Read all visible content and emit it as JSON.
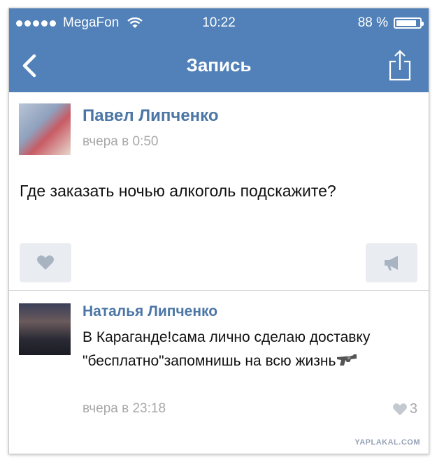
{
  "status_bar": {
    "carrier": "MegaFon",
    "time": "10:22",
    "battery_text": "88 %",
    "battery_level": 0.88
  },
  "nav": {
    "title": "Запись",
    "back_icon": "chevron-left-icon",
    "share_icon": "share-icon"
  },
  "post": {
    "author": "Павел Липченко",
    "date": "вчера в 0:50",
    "text": "Где заказать ночью алкоголь подскажите?"
  },
  "comment": {
    "author": "Наталья Липченко",
    "text": "В Караганде!сама лично сделаю доставку \"бесплатно\"запомнишь на всю жизнь",
    "date": "вчера в 23:18",
    "likes": "3"
  },
  "watermark": "YAPLAKAL.COM",
  "colors": {
    "header": "#5181b8",
    "author": "#4b76a6",
    "meta": "#a8a8a8",
    "button_bg": "#e9edf2"
  }
}
